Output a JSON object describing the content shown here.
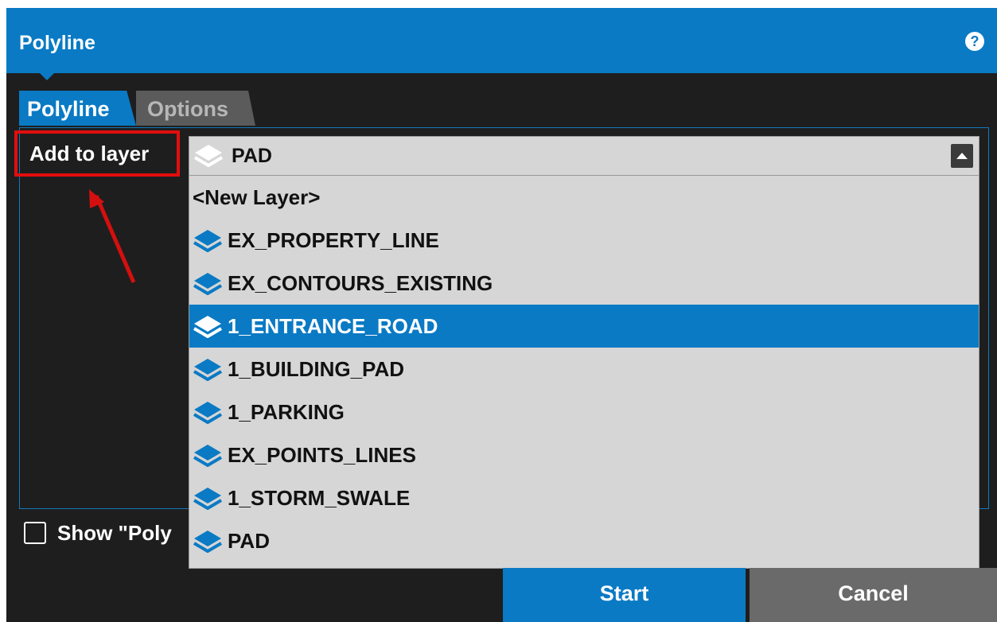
{
  "window": {
    "title": "Polyline",
    "help_glyph": "?"
  },
  "tabs": [
    {
      "label": "Polyline",
      "active": true
    },
    {
      "label": "Options",
      "active": false
    }
  ],
  "add_to_layer": {
    "label": "Add to layer",
    "highlight_color": "#e10e0e"
  },
  "layer_combo": {
    "selected_value": "PAD",
    "icon": "layers-icon",
    "expanded": true,
    "options": [
      {
        "label": "<New Layer>",
        "icon": ""
      },
      {
        "label": "EX_PROPERTY_LINE",
        "icon": "layers-icon"
      },
      {
        "label": "EX_CONTOURS_EXISTING",
        "icon": "layers-icon"
      },
      {
        "label": "1_ENTRANCE_ROAD",
        "icon": "layers-icon",
        "highlighted": true
      },
      {
        "label": "1_BUILDING_PAD",
        "icon": "layers-icon"
      },
      {
        "label": "1_PARKING",
        "icon": "layers-icon"
      },
      {
        "label": "EX_POINTS_LINES",
        "icon": "layers-icon"
      },
      {
        "label": "1_STORM_SWALE",
        "icon": "layers-icon"
      },
      {
        "label": "PAD",
        "icon": "layers-icon"
      }
    ]
  },
  "show_checkbox": {
    "label": "Show \"Poly",
    "checked": false
  },
  "buttons": {
    "start": "Start",
    "cancel": "Cancel"
  },
  "colors": {
    "accent": "#0a7ac4",
    "panel_bg": "#1e1e1e",
    "dropdown_bg": "#d6d6d6"
  }
}
